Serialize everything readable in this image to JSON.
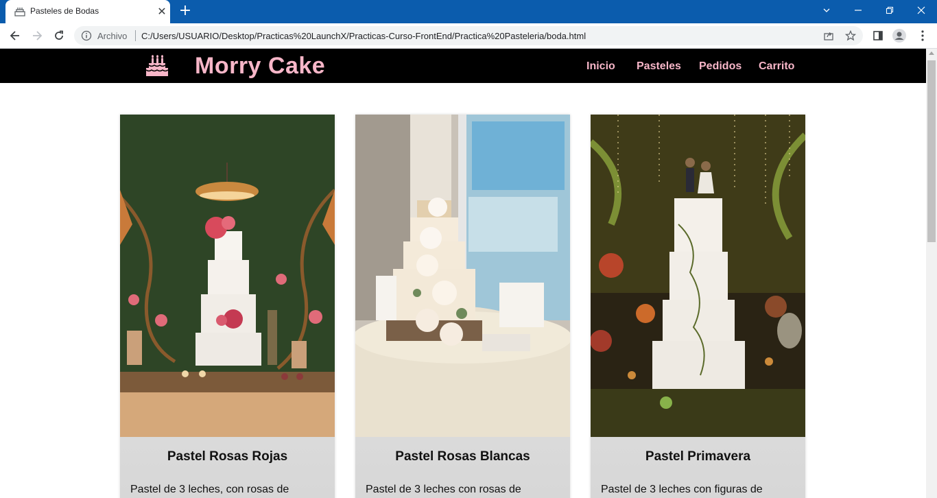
{
  "browser": {
    "tab_title": "Pasteles de Bodas",
    "new_tab": "+",
    "origin_label": "Archivo",
    "url": "C:/Users/USUARIO/Desktop/Practicas%20LaunchX/Practicas-Curso-FrontEnd/Practica%20Pasteleria/boda.html"
  },
  "site": {
    "brand": "Morry Cake",
    "nav": [
      "Inicio",
      "Pasteles",
      "Pedidos",
      "Carrito"
    ]
  },
  "cards": [
    {
      "title": "Pastel Rosas Rojas",
      "text": "Pastel de 3 leches, con rosas de"
    },
    {
      "title": "Pastel Rosas Blancas",
      "text": "Pastel de 3 leches con rosas de"
    },
    {
      "title": "Pastel Primavera",
      "text": "Pastel de 3 leches con figuras de"
    }
  ],
  "colors": {
    "chrome_titlebar": "#0b5cad",
    "header_bg": "#000000",
    "accent_pink": "#f7b6c8"
  }
}
